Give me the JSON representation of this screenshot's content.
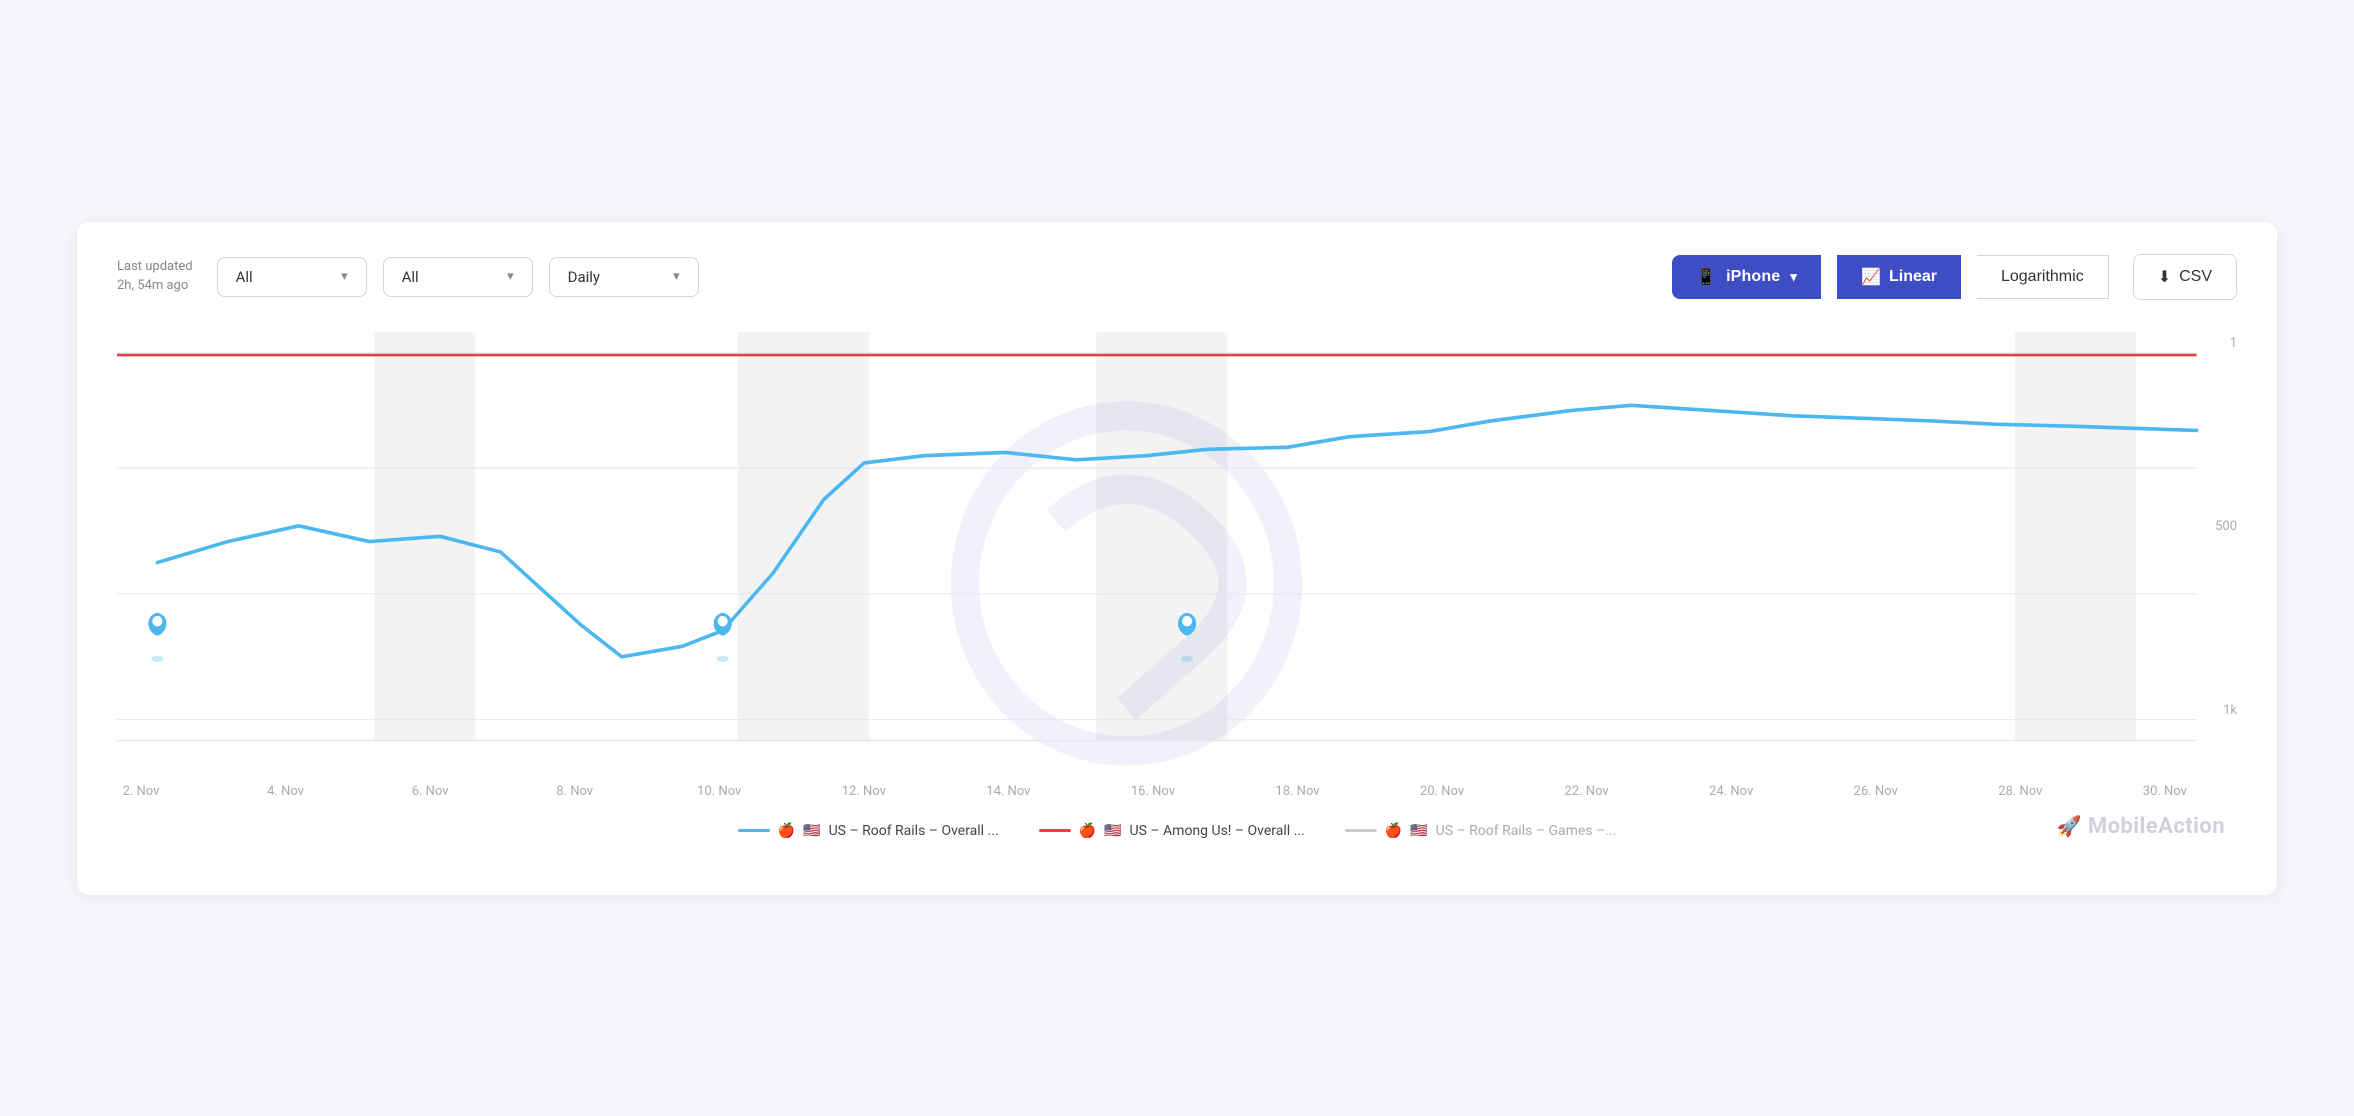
{
  "toolbar": {
    "last_updated_label": "Last updated",
    "last_updated_time": "2h, 54m ago",
    "filter1": {
      "value": "All",
      "placeholder": "All"
    },
    "filter2": {
      "value": "All",
      "placeholder": "All"
    },
    "filter3": {
      "value": "Daily",
      "placeholder": "Daily"
    },
    "btn_iphone": "iPhone",
    "btn_linear": "Linear",
    "btn_logarithmic": "Logarithmic",
    "btn_csv": "CSV"
  },
  "chart": {
    "y_labels": [
      "1",
      "500",
      "1k"
    ],
    "x_labels": [
      "2. Nov",
      "4. Nov",
      "6. Nov",
      "8. Nov",
      "10. Nov",
      "12. Nov",
      "14. Nov",
      "16. Nov",
      "18. Nov",
      "20. Nov",
      "22. Nov",
      "24. Nov",
      "26. Nov",
      "28. Nov",
      "30. Nov"
    ]
  },
  "legend": [
    {
      "id": "blue",
      "text": "US – Roof Rails – Overall ..."
    },
    {
      "id": "red",
      "text": "US – Among Us! – Overall ..."
    },
    {
      "id": "gray",
      "text": "US – Roof Rails – Games –..."
    }
  ],
  "watermark": "MobileAction"
}
